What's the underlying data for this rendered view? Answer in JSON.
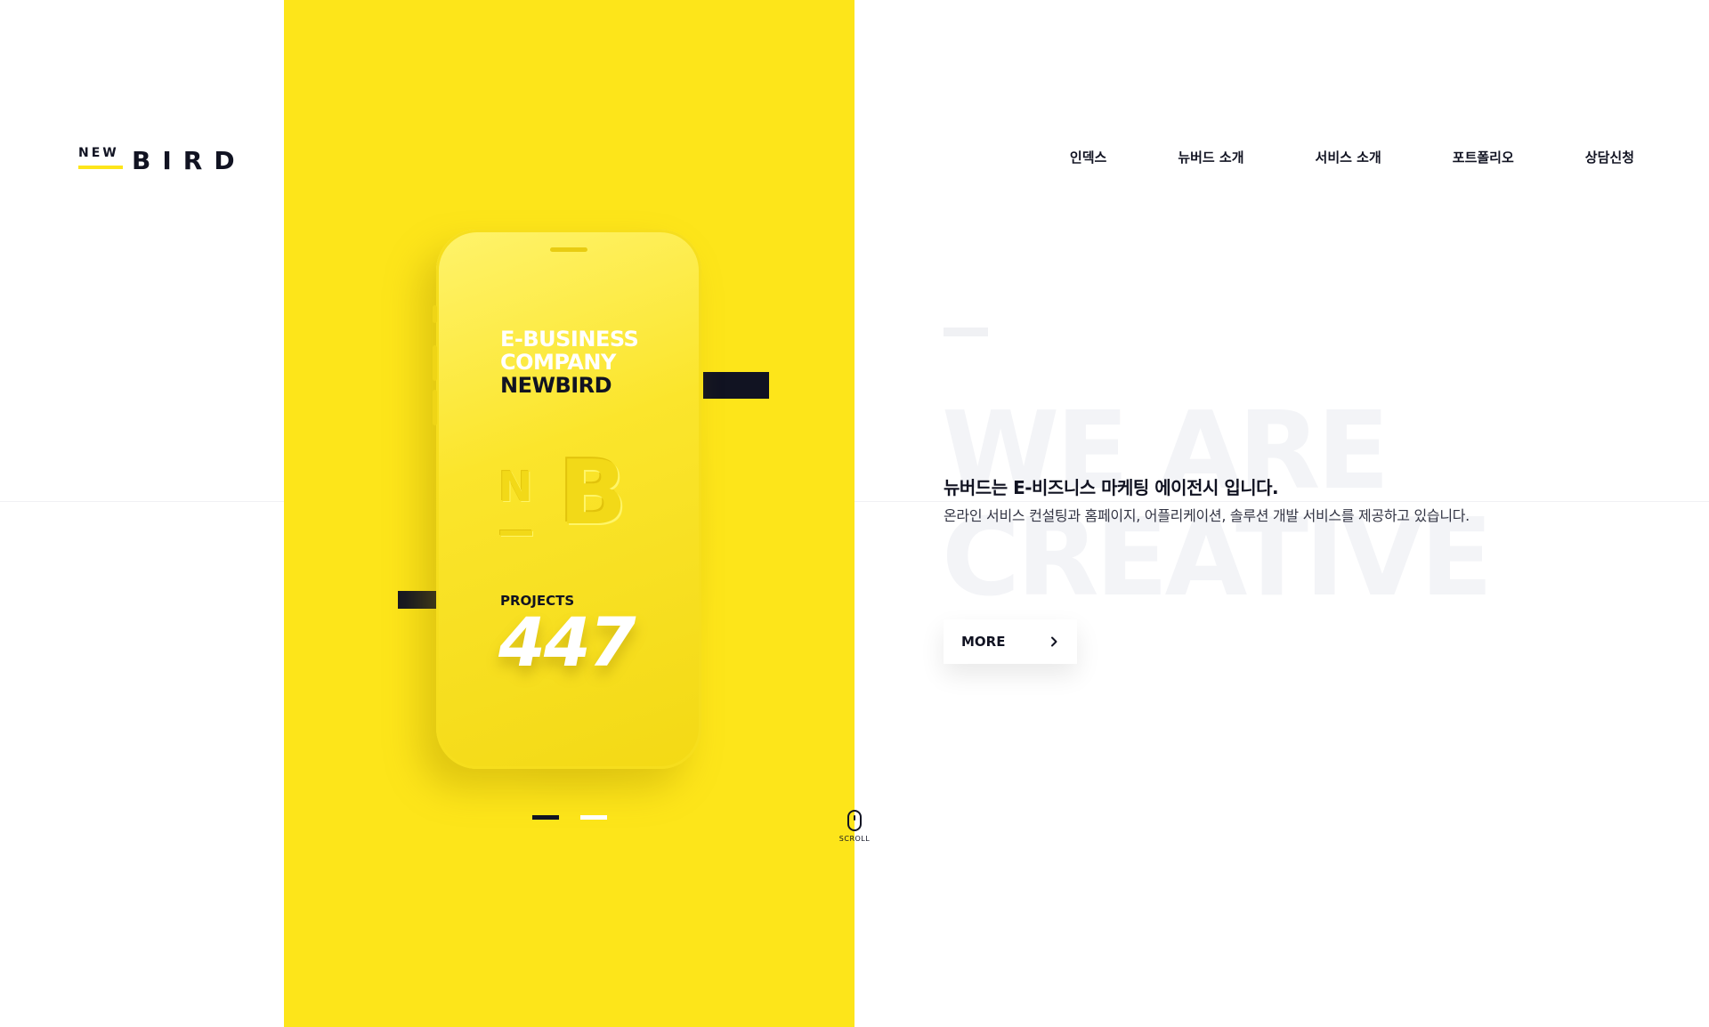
{
  "brand": {
    "logo_small": "NEW",
    "logo_large": "BIRD",
    "accent_color": "#fde51a",
    "dark_color": "#111322"
  },
  "nav": {
    "items": [
      {
        "label": "인덱스",
        "active": true
      },
      {
        "label": "뉴버드 소개",
        "active": false
      },
      {
        "label": "서비스 소개",
        "active": false
      },
      {
        "label": "포트폴리오",
        "active": false
      },
      {
        "label": "상담신청",
        "active": false
      }
    ]
  },
  "phone": {
    "line1": "E-BUSINESS",
    "line2": "COMPANY",
    "line3": "NEWBIRD",
    "monogram_n": "N",
    "monogram_b": "B",
    "projects_label": "PROJECTS",
    "projects_value": "447"
  },
  "slider": {
    "count": 2,
    "active_index": 0
  },
  "scroll": {
    "label": "SCROLL",
    "icon": "mouse-icon"
  },
  "hero": {
    "bg_text_line1": "WE ARE",
    "bg_text_line2": "CREATIVE",
    "headline": "뉴버드는 E-비즈니스 마케팅 에이전시 입니다.",
    "subline": "온라인 서비스 컨설팅과 홈페이지, 어플리케이션, 솔루션 개발 서비스를 제공하고 있습니다.",
    "more_label": "MORE",
    "more_icon": "chevron-right-icon"
  }
}
